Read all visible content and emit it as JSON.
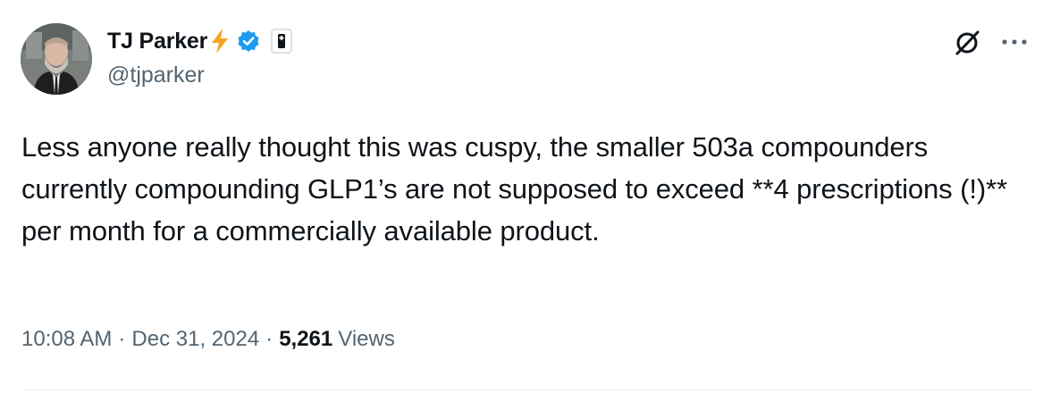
{
  "author": {
    "display_name": "TJ Parker",
    "handle": "@tjparker"
  },
  "tweet": {
    "text": "Less anyone really thought this was cuspy, the smaller 503a compounders currently compounding GLP1’s are not supposed to exceed **4 prescriptions (!)** per month for a commercially available product."
  },
  "meta": {
    "time": "10:08 AM",
    "separator": "·",
    "date": "Dec 31, 2024",
    "views_count": "5,261",
    "views_label": "Views"
  },
  "icons": {
    "bolt": "lightning-bolt-icon",
    "verified": "verified-badge-icon",
    "affiliation": "affiliation-badge-icon",
    "link": "unlink-icon",
    "more": "more-options-icon"
  },
  "colors": {
    "text_primary": "#0f1419",
    "text_secondary": "#536471",
    "verified_blue": "#1d9bf0",
    "bolt_orange": "#f5a623"
  }
}
